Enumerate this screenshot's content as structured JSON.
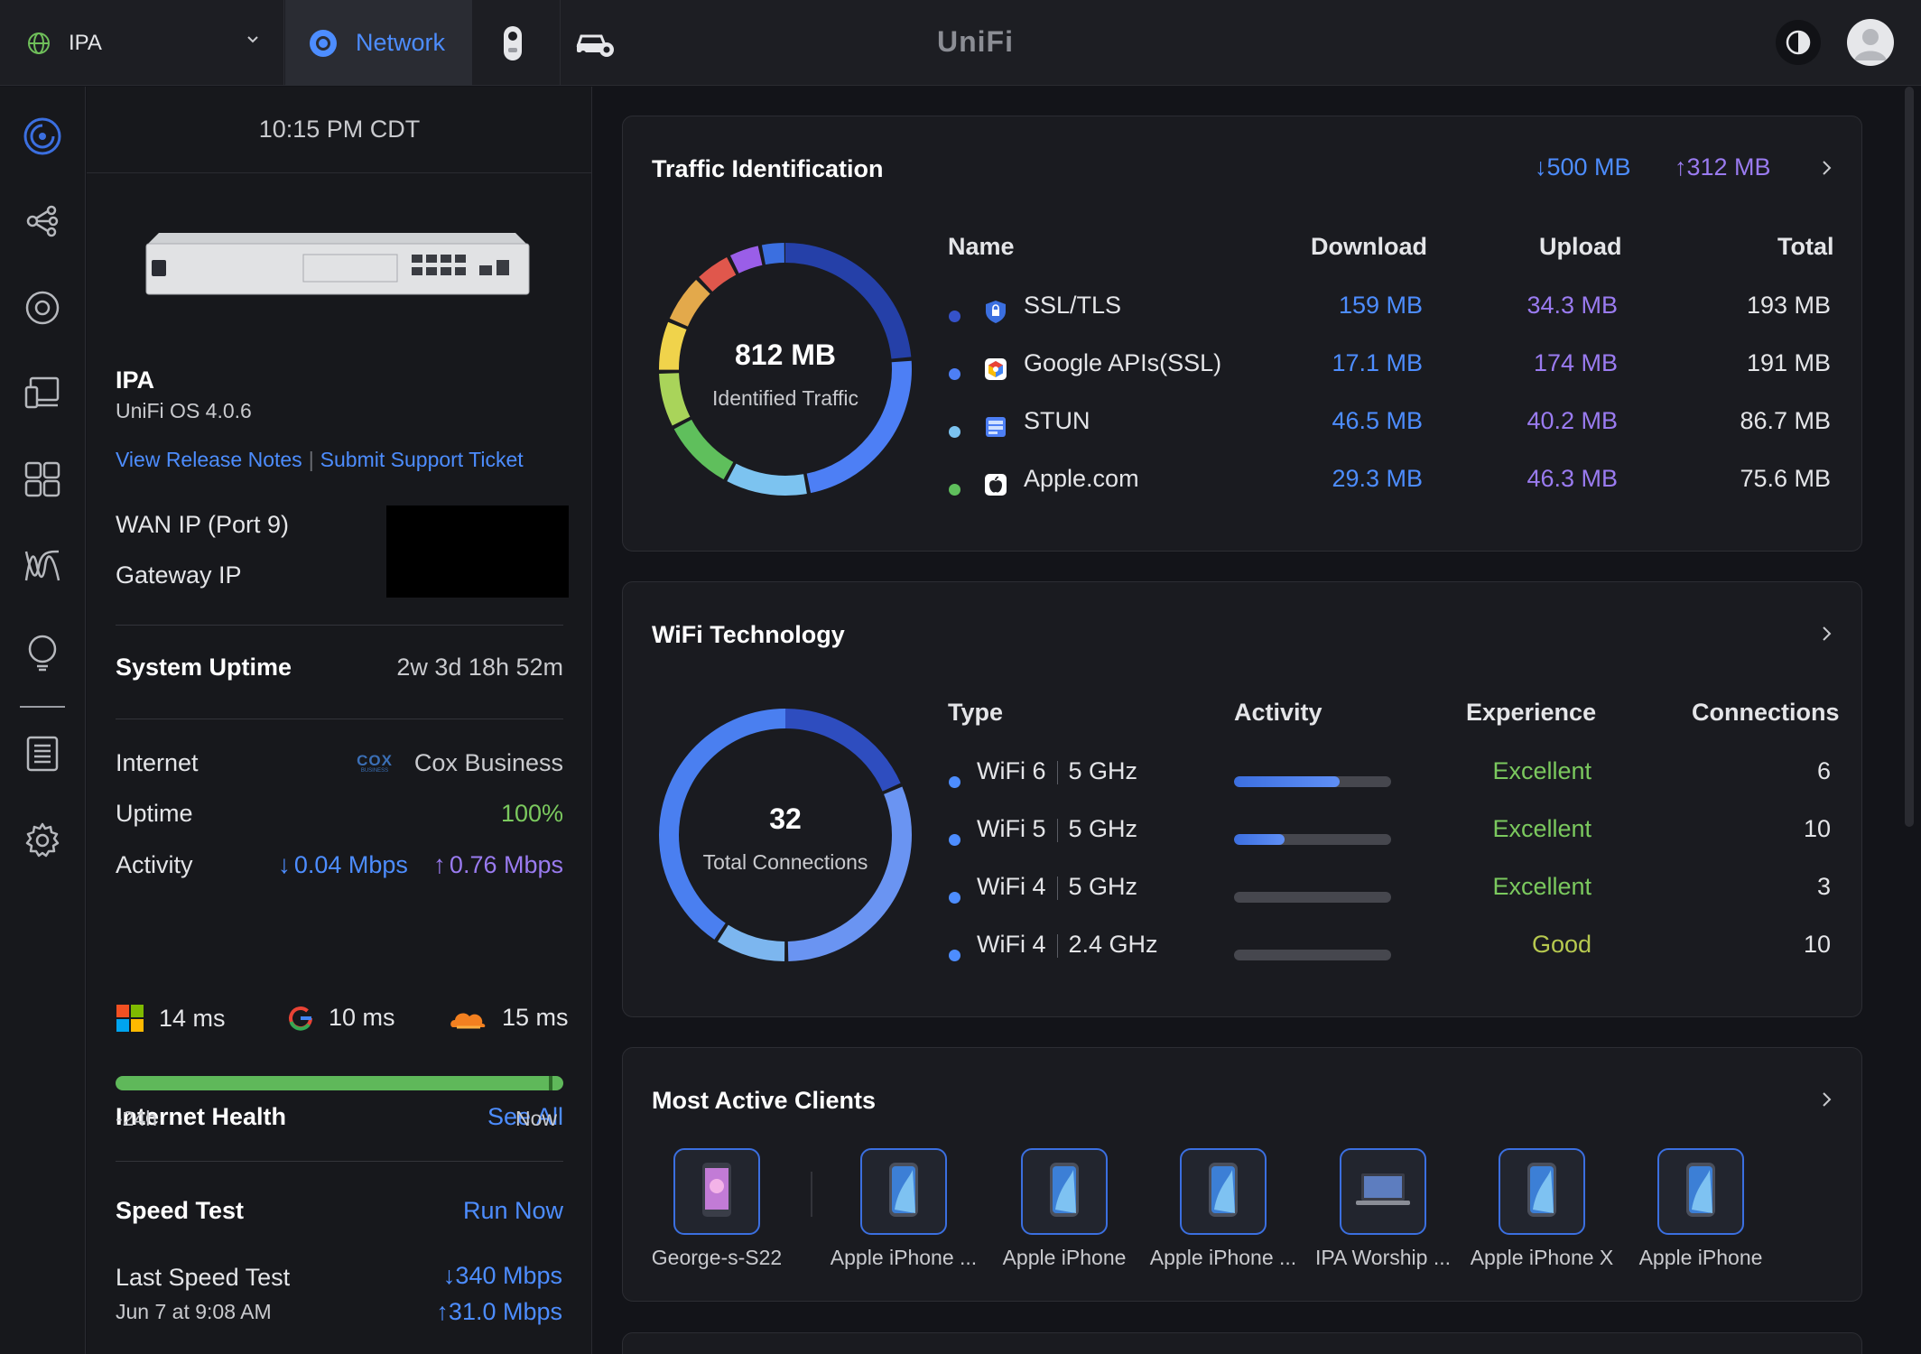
{
  "topbar": {
    "site_name": "IPA",
    "network_tab_label": "Network",
    "brand": "UniFi"
  },
  "device": {
    "time": "10:15 PM CDT",
    "name": "IPA",
    "os": "UniFi OS 4.0.6",
    "release_notes_link": "View Release Notes",
    "link_separator": "|",
    "support_link": "Submit Support Ticket",
    "wan_ip_label": "WAN IP (Port 9)",
    "gateway_ip_label": "Gateway IP",
    "system_uptime_label": "System Uptime",
    "system_uptime_value": "2w 3d 18h 52m",
    "internet_label": "Internet",
    "isp_logo_text": "COX",
    "isp_logo_subtext": "BUSINESS",
    "isp_name": "Cox Business",
    "uptime_label": "Uptime",
    "uptime_value": "100%",
    "activity_label": "Activity",
    "activity_down": "0.04 Mbps",
    "activity_up": "0.76 Mbps",
    "latency": [
      {
        "icon": "microsoft-icon",
        "value": "14 ms"
      },
      {
        "icon": "google-icon",
        "value": "10 ms"
      },
      {
        "icon": "cloudflare-icon",
        "value": "15 ms"
      }
    ],
    "internet_health_label": "Internet Health",
    "see_all_label": "See All",
    "health_start_label": "-24h",
    "health_end_label": "Now",
    "speed_test_label": "Speed Test",
    "run_now_label": "Run Now",
    "last_speed_test_label": "Last Speed Test",
    "last_speed_test_date": "Jun 7 at 9:08 AM",
    "speed_down": "340 Mbps",
    "speed_up": "31.0 Mbps"
  },
  "traffic": {
    "title": "Traffic Identification",
    "total_down": "500 MB",
    "total_up": "312 MB",
    "center_value": "812 MB",
    "center_label": "Identified Traffic",
    "headers": {
      "name": "Name",
      "download": "Download",
      "upload": "Upload",
      "total": "Total"
    },
    "rows": [
      {
        "name": "SSL/TLS",
        "download": "159 MB",
        "upload": "34.3 MB",
        "total": "193 MB",
        "dot_color": "#3552c9",
        "icon": "shield-lock-icon"
      },
      {
        "name": "Google APIs(SSL)",
        "download": "17.1 MB",
        "upload": "174 MB",
        "total": "191 MB",
        "dot_color": "#4d7ff5",
        "icon": "google-apis-icon"
      },
      {
        "name": "STUN",
        "download": "46.5 MB",
        "upload": "40.2 MB",
        "total": "86.7 MB",
        "dot_color": "#7cc3f0",
        "icon": "server-icon"
      },
      {
        "name": "Apple.com",
        "download": "29.3 MB",
        "upload": "46.3 MB",
        "total": "75.6 MB",
        "dot_color": "#5fbf5c",
        "icon": "apple-icon"
      }
    ]
  },
  "wifi": {
    "title": "WiFi Technology",
    "center_value": "32",
    "center_label": "Total Connections",
    "headers": {
      "type": "Type",
      "activity": "Activity",
      "experience": "Experience",
      "connections": "Connections"
    },
    "rows": [
      {
        "tech": "WiFi 6",
        "band": "5 GHz",
        "activity": 0.67,
        "experience": "Excellent",
        "connections": "6",
        "exp_color": "#7bc95e"
      },
      {
        "tech": "WiFi 5",
        "band": "5 GHz",
        "activity": 0.32,
        "experience": "Excellent",
        "connections": "10",
        "exp_color": "#7bc95e"
      },
      {
        "tech": "WiFi 4",
        "band": "5 GHz",
        "activity": 0.0,
        "experience": "Excellent",
        "connections": "3",
        "exp_color": "#7bc95e"
      },
      {
        "tech": "WiFi 4",
        "band": "2.4 GHz",
        "activity": 0.0,
        "experience": "Good",
        "connections": "10",
        "exp_color": "#b7c94f"
      }
    ]
  },
  "clients": {
    "title": "Most Active Clients",
    "items": [
      {
        "name": "George-s-S22",
        "icon": "android-phone-icon"
      },
      {
        "name": "Apple iPhone ...",
        "icon": "iphone-icon"
      },
      {
        "name": "Apple iPhone",
        "icon": "iphone-icon"
      },
      {
        "name": "Apple iPhone ...",
        "icon": "iphone-icon"
      },
      {
        "name": "IPA Worship ...",
        "icon": "laptop-icon"
      },
      {
        "name": "Apple iPhone X",
        "icon": "iphone-icon"
      },
      {
        "name": "Apple iPhone",
        "icon": "iphone-icon"
      }
    ]
  },
  "colors": {
    "accent": "#4d8dff",
    "upload_purple": "#9a7bf0",
    "good_green": "#7bc95e"
  }
}
